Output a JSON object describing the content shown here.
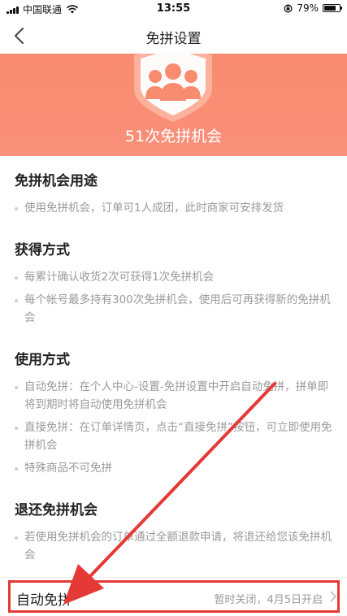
{
  "status_bar": {
    "carrier": "中国联通",
    "time": "13:55",
    "battery": "79%",
    "battery_level": 0.79
  },
  "nav": {
    "title": "免拼设置"
  },
  "hero": {
    "count_text": "51次免拼机会"
  },
  "sections": [
    {
      "title": "免拼机会用途",
      "items": [
        "使用免拼机会，订单可1人成团，此时商家可安排发货"
      ]
    },
    {
      "title": "获得方式",
      "items": [
        "每累计确认收货2次可获得1次免拼机会",
        "每个帐号最多持有300次免拼机会，使用后可再获得新的免拼机会"
      ]
    },
    {
      "title": "使用方式",
      "items": [
        "自动免拼：在个人中心-设置-免拼设置中开启自动免拼，拼单即将到期时将自动使用免拼机会",
        "直接免拼：在订单详情页，点击“直接免拼”按钮，可立即使用免拼机会",
        "特殊商品不可免拼"
      ]
    },
    {
      "title": "退还免拼机会",
      "items": [
        "若使用免拼机会的订单通过全额退款申请，将退还给您该免拼机会"
      ]
    }
  ],
  "auto_row": {
    "label": "自动免拼",
    "status": "暂时关闭，4月5日开启"
  },
  "colors": {
    "hero": "#f98c6f",
    "highlight": "#e53935"
  }
}
